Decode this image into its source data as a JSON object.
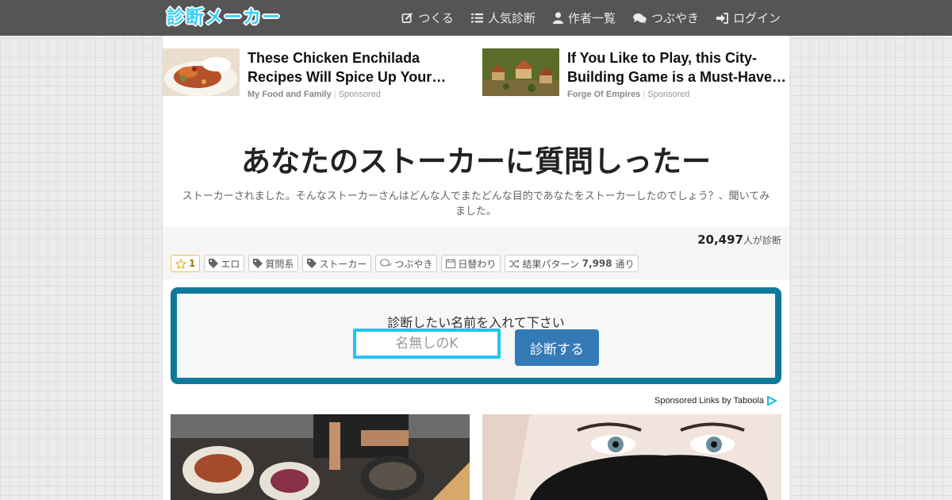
{
  "site": {
    "logo": "診断メーカー"
  },
  "nav": [
    {
      "label": "つくる",
      "icon": "edit-icon"
    },
    {
      "label": "人気診断",
      "icon": "list-icon"
    },
    {
      "label": "作者一覧",
      "icon": "user-icon"
    },
    {
      "label": "つぶやき",
      "icon": "comments-icon"
    },
    {
      "label": "ログイン",
      "icon": "sign-in-icon"
    }
  ],
  "ads": [
    {
      "title": "These Chicken Enchilada Recipes Will Spice Up Your…",
      "source": "My Food and Family",
      "sponsored": "Sponsored"
    },
    {
      "title": "If You Like to Play, this City-Building Game is a Must-Have…",
      "source": "Forge Of Empires",
      "sponsored": "Sponsored"
    }
  ],
  "diagnosis": {
    "title": "あなたのストーカーに質問しったー",
    "description": "ストーカーされました。そんなストーカーさんはどんな人でまたどんな目的であなたをストーカーしたのでしょう？、聞いてみました。",
    "count": "20,497",
    "count_suffix": "人が診断"
  },
  "tags": {
    "favorite_count": "1",
    "items": [
      "エロ",
      "質問系",
      "ストーカー"
    ],
    "tweets": "つぶやき",
    "daily": "日替わり",
    "patterns_prefix": "結果パターン",
    "patterns_count": "7,998",
    "patterns_suffix": "通り"
  },
  "form": {
    "label": "診断したい名前を入れて下さい",
    "placeholder": "名無しのK",
    "button": "診断する"
  },
  "taboola": {
    "label": "Sponsored Links by Taboola"
  },
  "colors": {
    "topbar": "#555555",
    "form_border": "#0d7a9c",
    "input_border": "#22c3ee",
    "button": "#337ab7"
  }
}
